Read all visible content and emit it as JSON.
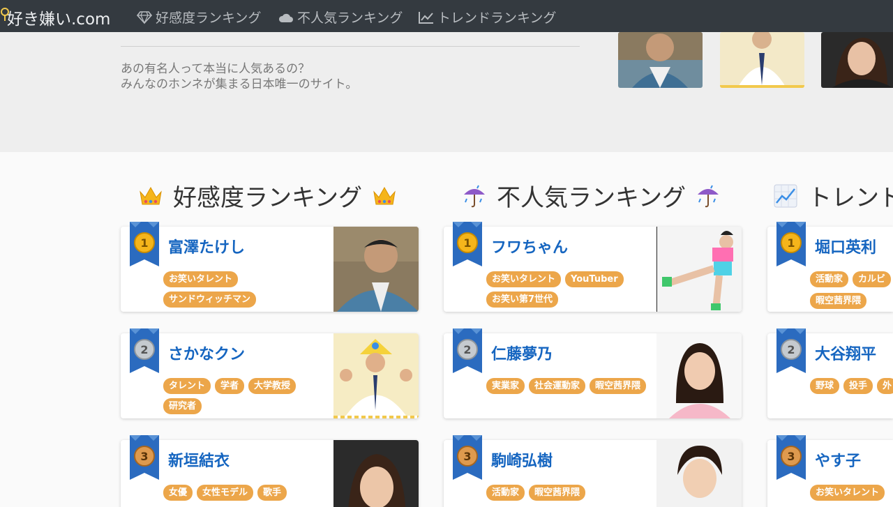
{
  "brand": {
    "text": "好き嫌い.com"
  },
  "nav": {
    "likes": "好感度ランキング",
    "dislikes": "不人気ランキング",
    "trend": "トレンドランキング"
  },
  "hero": {
    "line1": "あの有名人って本当に人気あるの？",
    "line2": "みんなのホンネが集まる日本唯一のサイト。"
  },
  "sections": {
    "likes": {
      "title": "好感度ランキング",
      "cards": [
        {
          "rank": "1",
          "name": "富澤たけし",
          "tags": [
            "お笑いタレント",
            "サンドウィッチマン"
          ]
        },
        {
          "rank": "2",
          "name": "さかなクン",
          "tags": [
            "タレント",
            "学者",
            "大学教授",
            "研究者"
          ]
        },
        {
          "rank": "3",
          "name": "新垣結衣",
          "tags": [
            "女優",
            "女性モデル",
            "歌手"
          ]
        }
      ]
    },
    "dislikes": {
      "title": "不人気ランキング",
      "cards": [
        {
          "rank": "1",
          "name": "フワちゃん",
          "tags": [
            "お笑いタレント",
            "YouTuber",
            "お笑い第7世代"
          ]
        },
        {
          "rank": "2",
          "name": "仁藤夢乃",
          "tags": [
            "実業家",
            "社会運動家",
            "暇空茜界隈"
          ]
        },
        {
          "rank": "3",
          "name": "駒崎弘樹",
          "tags": [
            "活動家",
            "暇空茜界隈"
          ]
        }
      ]
    },
    "trend": {
      "title": "トレンド",
      "cards": [
        {
          "rank": "1",
          "name": "堀口英利",
          "tags": [
            "活動家",
            "カルビ",
            "暇空茜界隈"
          ]
        },
        {
          "rank": "2",
          "name": "大谷翔平",
          "tags": [
            "野球",
            "投手",
            "外"
          ]
        },
        {
          "rank": "3",
          "name": "やす子",
          "tags": [
            "お笑いタレント"
          ]
        }
      ]
    }
  },
  "colors": {
    "navbar": "#343a40",
    "tag": "#eca64a",
    "name": "#1565c0",
    "gold": "#f5b51b",
    "silver": "#b9bec4",
    "bronze": "#d08a3a",
    "ribbon": "#2b6bbf"
  }
}
